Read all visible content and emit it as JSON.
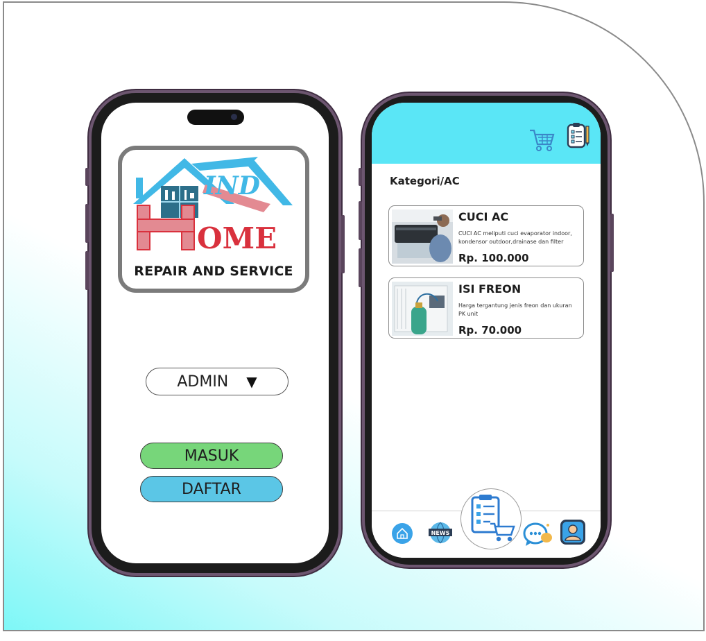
{
  "login": {
    "logo_subtitle": "REPAIR AND SERVICE",
    "role_select": {
      "value": "ADMIN",
      "arrow": "▼"
    },
    "masuk_label": "MASUK",
    "daftar_label": "DAFTAR"
  },
  "catalog": {
    "title": "Kategori/AC",
    "services": [
      {
        "name": "CUCI AC",
        "description": "CUCI AC meliputi cuci evaporator indoor, kondensor outdoor,drainase dan filter",
        "price": "Rp. 100.000"
      },
      {
        "name": "ISI FREON",
        "description": "Harga tergantung jenis freon dan ukuran PK unit",
        "price": "Rp. 70.000"
      }
    ],
    "header_icons": [
      "cart-icon",
      "order-list-icon"
    ],
    "nav_items": [
      "home-icon",
      "news-icon",
      "order-checklist-cart-icon",
      "chat-icon",
      "profile-icon"
    ],
    "news_badge": "NEWS"
  },
  "colors": {
    "header": "#5ae6f6",
    "masuk": "#77d67a",
    "daftar": "#5bc6e6",
    "logo_red": "#d9313d",
    "logo_blue": "#41b8e6"
  }
}
